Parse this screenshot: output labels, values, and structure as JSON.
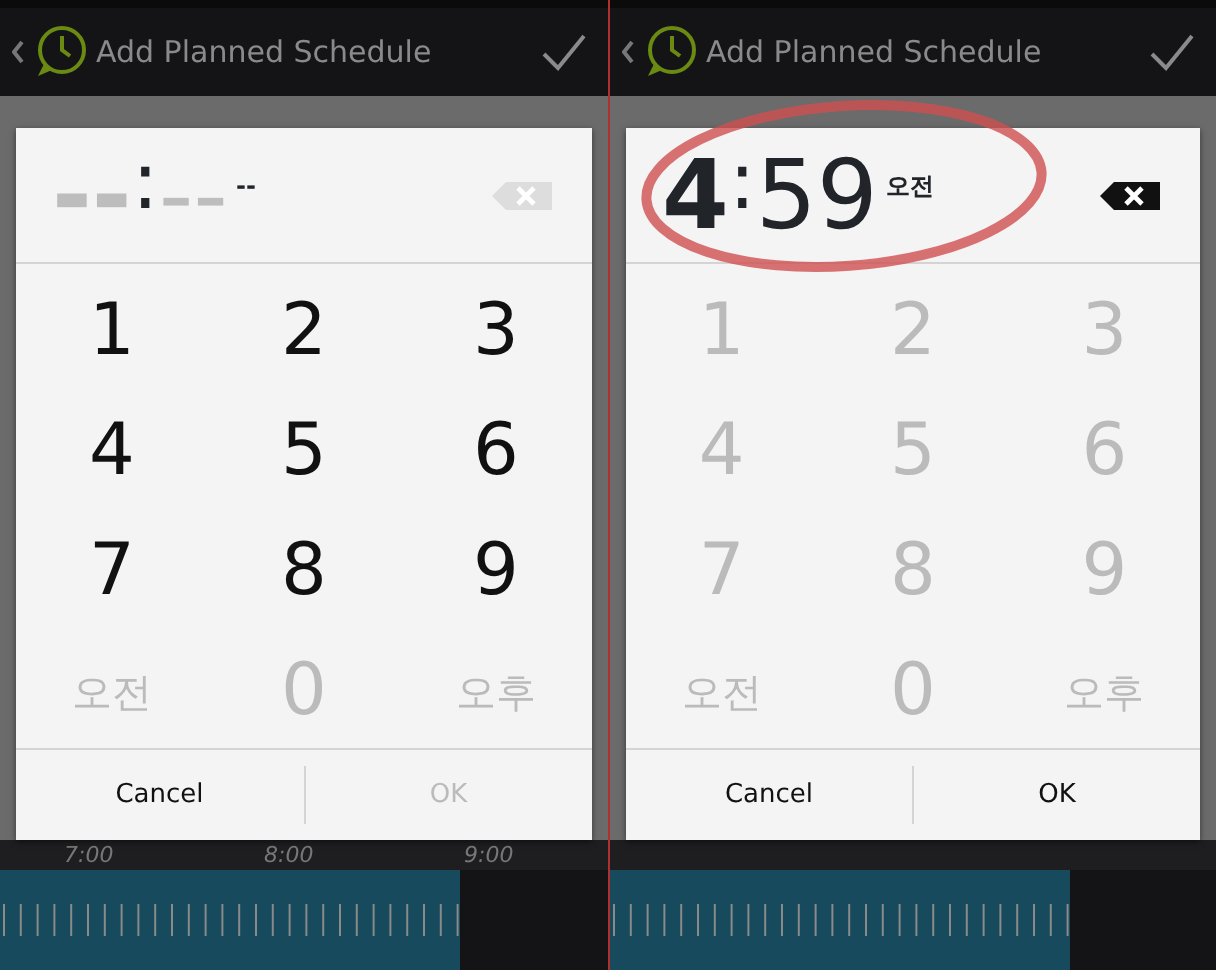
{
  "panels": [
    {
      "header": {
        "title": "Add Planned Schedule"
      },
      "highlight": false,
      "display": {
        "hour": "--",
        "separator": ":",
        "minute": "--",
        "ampm": "--",
        "entered": false
      },
      "keys": [
        {
          "label": "1",
          "disabled": false
        },
        {
          "label": "2",
          "disabled": false
        },
        {
          "label": "3",
          "disabled": false
        },
        {
          "label": "4",
          "disabled": false
        },
        {
          "label": "5",
          "disabled": false
        },
        {
          "label": "6",
          "disabled": false
        },
        {
          "label": "7",
          "disabled": false
        },
        {
          "label": "8",
          "disabled": false
        },
        {
          "label": "9",
          "disabled": false
        },
        {
          "label": "오전",
          "disabled": true
        },
        {
          "label": "0",
          "disabled": true
        },
        {
          "label": "오후",
          "disabled": true
        }
      ],
      "buttons": [
        {
          "label": "Cancel",
          "disabled": false
        },
        {
          "label": "OK",
          "disabled": true
        }
      ],
      "timeline": {
        "labels": [
          "7:00",
          "8:00",
          "9:00"
        ]
      }
    },
    {
      "header": {
        "title": "Add Planned Schedule"
      },
      "highlight": true,
      "display": {
        "hour": "4",
        "separator": ":",
        "minute": "59",
        "ampm": "오전",
        "entered": true
      },
      "keys": [
        {
          "label": "1",
          "disabled": true
        },
        {
          "label": "2",
          "disabled": true
        },
        {
          "label": "3",
          "disabled": true
        },
        {
          "label": "4",
          "disabled": true
        },
        {
          "label": "5",
          "disabled": true
        },
        {
          "label": "6",
          "disabled": true
        },
        {
          "label": "7",
          "disabled": true
        },
        {
          "label": "8",
          "disabled": true
        },
        {
          "label": "9",
          "disabled": true
        },
        {
          "label": "오전",
          "disabled": true
        },
        {
          "label": "0",
          "disabled": true
        },
        {
          "label": "오후",
          "disabled": true
        }
      ],
      "buttons": [
        {
          "label": "Cancel",
          "disabled": false
        },
        {
          "label": "OK",
          "disabled": false
        }
      ]
    }
  ]
}
